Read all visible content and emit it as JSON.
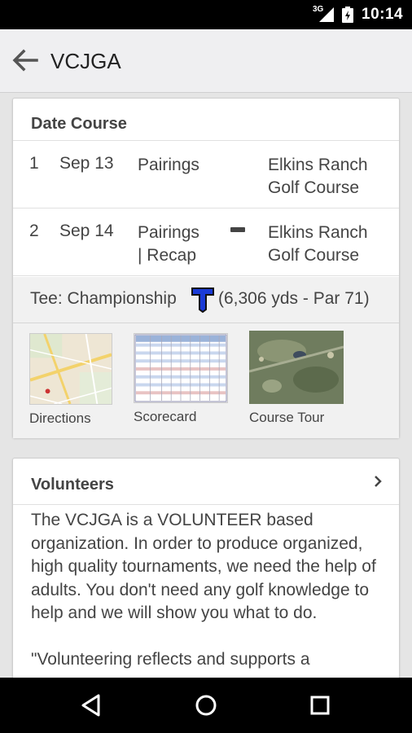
{
  "status_bar": {
    "network": "3G",
    "time": "10:14"
  },
  "app_bar": {
    "title": "VCJGA"
  },
  "schedule": {
    "header": "Date Course",
    "rows": [
      {
        "num": "1",
        "date": "Sep 13",
        "links": "Pairings",
        "course_line1": "Elkins Ranch",
        "course_line2": "Golf Course"
      },
      {
        "num": "2",
        "date": "Sep 14",
        "links_line1": "Pairings",
        "links_line2": "| Recap",
        "course_line1": "Elkins Ranch",
        "course_line2": "Golf Course"
      }
    ],
    "tee_label": "Tee: Championship",
    "tee_details": "(6,306 yds - Par 71)",
    "tiles": [
      {
        "caption": "Directions"
      },
      {
        "caption": "Scorecard"
      },
      {
        "caption": "Course Tour"
      }
    ]
  },
  "volunteers": {
    "header": "Volunteers",
    "body": "The VCJGA is a VOLUNTEER based organization. In order to produce organized, high quality tournaments, we need the help of adults. You don't need any golf knowledge to help and we will show you what to do.",
    "quote": "\"Volunteering reflects and supports a"
  },
  "colors": {
    "tee_icon": "#1a3bd6",
    "accent": "#444444"
  },
  "icons": [
    "back-arrow-icon",
    "signal-icon",
    "battery-icon",
    "minus-icon",
    "tee-marker-icon",
    "chevron-right-icon",
    "nav-back-icon",
    "nav-home-icon",
    "nav-recents-icon"
  ]
}
